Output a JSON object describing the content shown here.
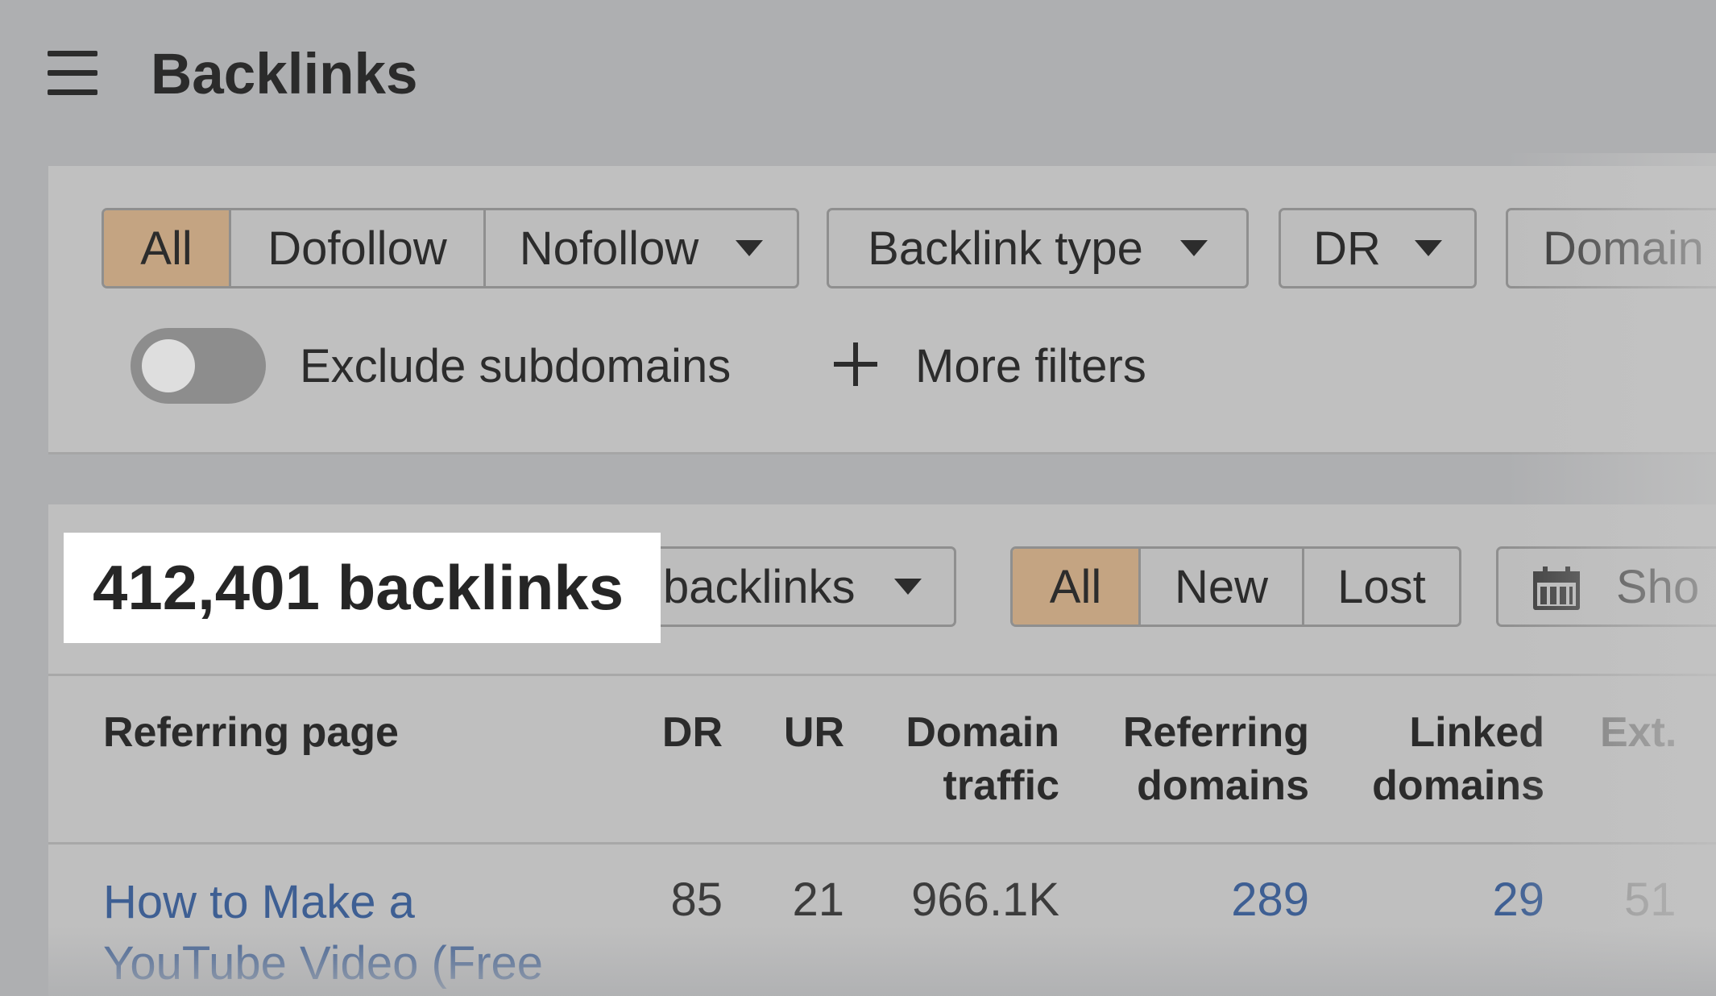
{
  "header": {
    "title": "Backlinks"
  },
  "filters": {
    "link_type": [
      "All",
      "Dofollow",
      "Nofollow"
    ],
    "backlink_type_label": "Backlink type",
    "dr_label": "DR",
    "domain_label": "Domain",
    "exclude_subdomains_label": "Exclude subdomains",
    "more_filters_label": "More filters"
  },
  "results": {
    "count_label": "412,401 backlinks",
    "group_label": "backlinks",
    "status_tabs": [
      "All",
      "New",
      "Lost"
    ],
    "date_label": "Sho"
  },
  "table": {
    "columns": {
      "referring_page": "Referring page",
      "dr": "DR",
      "ur": "UR",
      "domain_traffic": [
        "Domain",
        "traffic"
      ],
      "referring_domains": [
        "Referring",
        "domains"
      ],
      "linked_domains": [
        "Linked",
        "domains"
      ],
      "ext": "Ext."
    },
    "rows": [
      {
        "title": [
          "How to Make a",
          "YouTube Video (Free"
        ],
        "dr": "85",
        "ur": "21",
        "domain_traffic": "966.1K",
        "referring_domains": "289",
        "linked_domains": "29",
        "ext": "51"
      }
    ]
  },
  "colors": {
    "active_segment": "#c4a482",
    "link": "#3e5f93"
  }
}
